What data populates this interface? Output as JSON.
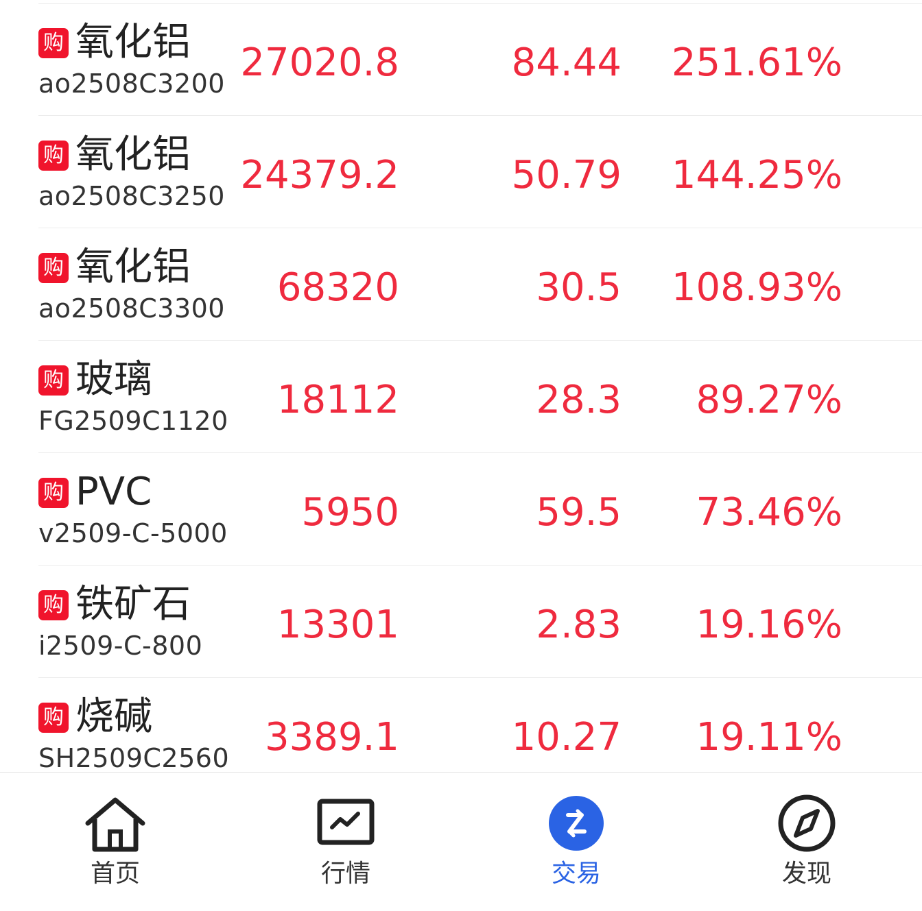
{
  "rows": [
    {
      "badge": "购",
      "name": "氧化铝",
      "code": "ao2508C3200",
      "price": "27020.8",
      "change": "84.44",
      "percent": "251.61%"
    },
    {
      "badge": "购",
      "name": "氧化铝",
      "code": "ao2508C3250",
      "price": "24379.2",
      "change": "50.79",
      "percent": "144.25%"
    },
    {
      "badge": "购",
      "name": "氧化铝",
      "code": "ao2508C3300",
      "price": "68320",
      "change": "30.5",
      "percent": "108.93%"
    },
    {
      "badge": "购",
      "name": "玻璃",
      "code": "FG2509C1120",
      "price": "18112",
      "change": "28.3",
      "percent": "89.27%"
    },
    {
      "badge": "购",
      "name": "PVC",
      "code": "v2509-C-5000",
      "price": "5950",
      "change": "59.5",
      "percent": "73.46%"
    },
    {
      "badge": "购",
      "name": "铁矿石",
      "code": "i2509-C-800",
      "price": "13301",
      "change": "2.83",
      "percent": "19.16%"
    },
    {
      "badge": "购",
      "name": "烧碱",
      "code": "SH2509C2560",
      "price": "3389.1",
      "change": "10.27",
      "percent": "19.11%"
    }
  ],
  "tabs": [
    {
      "label": "首页",
      "icon": "home-icon",
      "active": false
    },
    {
      "label": "行情",
      "icon": "market-chart-icon",
      "active": false
    },
    {
      "label": "交易",
      "icon": "trade-icon",
      "active": true
    },
    {
      "label": "发现",
      "icon": "compass-icon",
      "active": false
    }
  ],
  "colors": {
    "up": "#ef2a3e",
    "badge": "#f0142c",
    "active_tab": "#2a63e4",
    "text": "#222222"
  }
}
